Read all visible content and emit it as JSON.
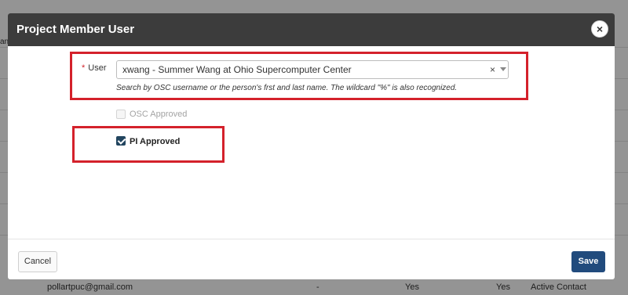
{
  "background": {
    "row": {
      "email": "pollartpuc@gmail.com",
      "dash": "-",
      "col_a": "Yes",
      "col_b": "Yes",
      "status": "Active Contact"
    }
  },
  "modal": {
    "title": "Project Member User",
    "close_icon": "×",
    "user_field": {
      "label": "User",
      "required_mark": "*",
      "value": "xwang - Summer Wang at Ohio Supercomputer Center",
      "clear_icon": "×",
      "help": "Search by OSC username or the person's frst and last name. The wildcard \"%\" is also recognized."
    },
    "osc_approved": {
      "label": "OSC Approved",
      "checked": false,
      "disabled": true
    },
    "pi_approved": {
      "label": "PI Approved",
      "checked": true,
      "disabled": false
    },
    "cancel_label": "Cancel",
    "save_label": "Save"
  },
  "colors": {
    "header": "#3c3c3c",
    "highlight": "#d4212b",
    "save": "#214b7d",
    "checkbox": "#22455f"
  },
  "icons": [
    "close-icon",
    "clear-icon",
    "chevron-down-icon",
    "checkmark-icon"
  ]
}
